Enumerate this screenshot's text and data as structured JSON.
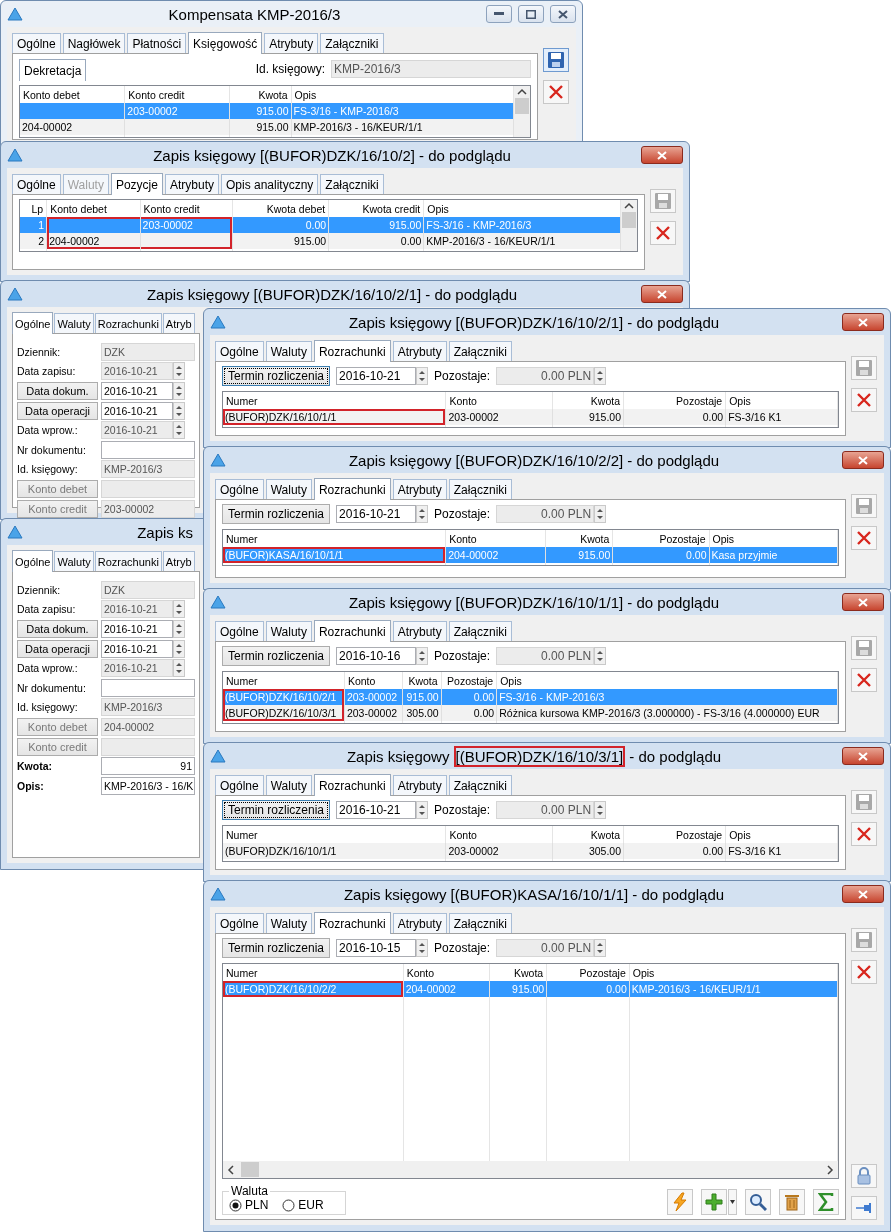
{
  "windows": [
    {
      "kind": "dekretacja",
      "title": [
        {
          "text": "Kompensata KMP-2016/3",
          "framed": false
        }
      ],
      "active": false,
      "controls": [
        {
          "kind": "minimize"
        },
        {
          "kind": "maximize"
        },
        {
          "kind": "close"
        }
      ],
      "tabs": [
        {
          "label": "Ogólne",
          "selected": false
        },
        {
          "label": "Nagłówek",
          "selected": false
        },
        {
          "label": "Płatności",
          "selected": false
        },
        {
          "label": "Księgowość",
          "selected": true
        },
        {
          "label": "Atrybuty",
          "selected": false
        },
        {
          "label": "Załączniki",
          "selected": false
        }
      ],
      "subtab": "Dekretacja",
      "id_label": "Id. księgowy:",
      "id_value": "KMP-2016/3",
      "table": {
        "scrollbar": {
          "kind": "vertical"
        },
        "columns": [
          {
            "label": "Konto debet",
            "kind": "text",
            "framed": false
          },
          {
            "label": "Konto credit",
            "kind": "text",
            "framed": false
          },
          {
            "label": "Kwota",
            "kind": "number",
            "framed": false
          },
          {
            "label": "Opis",
            "kind": "text",
            "framed": false
          }
        ],
        "rows": [
          {
            "selected": true,
            "cells": [
              null,
              "203-00002",
              "915.00",
              "FS-3/16 - KMP-2016/3"
            ]
          },
          {
            "selected": false,
            "cells": [
              "204-00002",
              null,
              "915.00",
              "KMP-2016/3 - 16/KEUR/1/1"
            ]
          }
        ]
      },
      "side_buttons": [
        {
          "kind": "save",
          "disabled": false
        },
        {
          "kind": "delete",
          "disabled": false
        }
      ]
    },
    {
      "kind": "pozycje",
      "title": [
        {
          "text": "Zapis księgowy [(BUFOR)DZK/16/10/2] - do podglądu",
          "framed": false
        }
      ],
      "active": true,
      "controls": [
        {
          "kind": "close"
        }
      ],
      "tabs": [
        {
          "label": "Ogólne",
          "selected": false,
          "disabled": false
        },
        {
          "label": "Waluty",
          "selected": false,
          "disabled": true
        },
        {
          "label": "Pozycje",
          "selected": true,
          "disabled": false
        },
        {
          "label": "Atrybuty",
          "selected": false,
          "disabled": false
        },
        {
          "label": "Opis analityczny",
          "selected": false,
          "disabled": false
        },
        {
          "label": "Załączniki",
          "selected": false,
          "disabled": false
        }
      ],
      "table": {
        "scrollbar": {
          "kind": "vertical"
        },
        "columns": [
          {
            "label": "Lp",
            "kind": "number",
            "framed": false
          },
          {
            "label": "Konto debet",
            "kind": "text",
            "framed": true
          },
          {
            "label": "Konto credit",
            "kind": "text",
            "framed": true
          },
          {
            "label": "Kwota debet",
            "kind": "number",
            "framed": false
          },
          {
            "label": "Kwota credit",
            "kind": "number",
            "framed": false
          },
          {
            "label": "Opis",
            "kind": "text",
            "framed": false
          }
        ],
        "rows": [
          {
            "selected": true,
            "cells": [
              "1",
              null,
              "203-00002",
              "0.00",
              "915.00",
              "FS-3/16 - KMP-2016/3"
            ]
          },
          {
            "selected": false,
            "cells": [
              "2",
              "204-00002",
              null,
              "915.00",
              "0.00",
              "KMP-2016/3 - 16/KEUR/1/1"
            ]
          }
        ]
      },
      "side_buttons": [
        {
          "kind": "save",
          "disabled": true
        },
        {
          "kind": "delete",
          "disabled": false
        }
      ]
    },
    {
      "kind": "form",
      "title": [
        {
          "text": "Zapis księgowy [(BUFOR)DZK/16/10/2/1] - do podglądu",
          "framed": false
        }
      ],
      "active": true,
      "controls": [
        {
          "kind": "close"
        }
      ],
      "tabs": [
        {
          "label": "Ogólne",
          "selected": true
        },
        {
          "label": "Waluty",
          "selected": false
        },
        {
          "label": "Rozrachunki",
          "selected": false
        },
        {
          "label": "Atryb",
          "selected": false
        }
      ],
      "rows": [
        {
          "label": "Dziennik:",
          "kind": "text",
          "value": "DZK",
          "disabled": true,
          "emphasis": false
        },
        {
          "label": "Data zapisu:",
          "kind": "date",
          "value": "2016-10-21",
          "disabled": true,
          "emphasis": false
        },
        {
          "label": "Data dokum.",
          "kind": "button-date",
          "value": "2016-10-21",
          "disabled": false,
          "emphasis": false
        },
        {
          "label": "Data operacji",
          "kind": "button-date",
          "value": "2016-10-21",
          "disabled": false,
          "emphasis": false
        },
        {
          "label": "Data wprow.:",
          "kind": "date",
          "value": "2016-10-21",
          "disabled": true,
          "emphasis": false
        },
        {
          "label": "Nr dokumentu:",
          "kind": "text",
          "disabled": false,
          "emphasis": false
        },
        {
          "label": "Id. księgowy:",
          "kind": "text",
          "value": "KMP-2016/3",
          "disabled": true,
          "emphasis": false
        },
        {
          "label": "Konto debet",
          "kind": "button",
          "disabled": true,
          "emphasis": false
        },
        {
          "label": "Konto credit",
          "kind": "button",
          "value": "203-00002",
          "disabled": true,
          "emphasis": false
        }
      ]
    },
    {
      "kind": "rozrachunki",
      "title": [
        {
          "text": "Zapis księgowy [(BUFOR)DZK/16/10/2/1] - do podglądu",
          "framed": false
        }
      ],
      "active": true,
      "controls": [
        {
          "kind": "close"
        }
      ],
      "tabs": [
        {
          "label": "Ogólne",
          "selected": false
        },
        {
          "label": "Waluty",
          "selected": false
        },
        {
          "label": "Rozrachunki",
          "selected": true
        },
        {
          "label": "Atrybuty",
          "selected": false
        },
        {
          "label": "Załączniki",
          "selected": false
        }
      ],
      "termin": {
        "label": "Termin rozliczenia",
        "focused": true
      },
      "date": "2016-10-21",
      "remaining_label": "Pozostaje:",
      "remaining": "0.00 PLN",
      "table": {
        "columns": [
          {
            "label": "Numer",
            "kind": "text",
            "framed": true
          },
          {
            "label": "Konto",
            "kind": "text",
            "framed": false
          },
          {
            "label": "Kwota",
            "kind": "number",
            "framed": false
          },
          {
            "label": "Pozostaje",
            "kind": "number",
            "framed": false
          },
          {
            "label": "Opis",
            "kind": "text",
            "framed": false
          }
        ],
        "rows": [
          {
            "selected": false,
            "cells": [
              "(BUFOR)DZK/16/10/1/1",
              "203-00002",
              "915.00",
              "0.00",
              "FS-3/16 K1"
            ]
          }
        ]
      },
      "side_buttons": [
        {
          "kind": "save",
          "disabled": true
        },
        {
          "kind": "delete",
          "disabled": false
        }
      ]
    },
    {
      "kind": "form",
      "title": [
        {
          "text": "Zapis ks",
          "framed": false
        }
      ],
      "tabs": [
        {
          "label": "Ogólne",
          "selected": true
        },
        {
          "label": "Waluty",
          "selected": false
        },
        {
          "label": "Rozrachunki",
          "selected": false
        },
        {
          "label": "Atryb",
          "selected": false
        }
      ],
      "rows": [
        {
          "label": "Dziennik:",
          "kind": "text",
          "value": "DZK",
          "disabled": true,
          "emphasis": false
        },
        {
          "label": "Data zapisu:",
          "kind": "date",
          "value": "2016-10-21",
          "disabled": true,
          "emphasis": false
        },
        {
          "label": "Data dokum.",
          "kind": "button-date",
          "value": "2016-10-21",
          "disabled": false,
          "emphasis": false
        },
        {
          "label": "Data operacji",
          "kind": "button-date",
          "value": "2016-10-21",
          "disabled": false,
          "emphasis": false
        },
        {
          "label": "Data wprow.:",
          "kind": "date",
          "value": "2016-10-21",
          "disabled": true,
          "emphasis": false
        },
        {
          "label": "Nr dokumentu:",
          "kind": "text",
          "disabled": false,
          "emphasis": false
        },
        {
          "label": "Id. księgowy:",
          "kind": "text",
          "value": "KMP-2016/3",
          "disabled": true,
          "emphasis": false
        },
        {
          "label": "Konto debet",
          "kind": "button",
          "value": "204-00002",
          "disabled": true,
          "emphasis": false
        },
        {
          "label": "Konto credit",
          "kind": "button",
          "disabled": true,
          "emphasis": false
        },
        {
          "label": "Kwota:",
          "kind": "amount",
          "value": "91",
          "disabled": false,
          "emphasis": true
        },
        {
          "label": "Opis:",
          "kind": "text",
          "value": "KMP-2016/3 - 16/K",
          "disabled": false,
          "emphasis": true
        }
      ]
    },
    {
      "kind": "rozrachunki",
      "title": [
        {
          "text": "Zapis księgowy [(BUFOR)DZK/16/10/2/2] - do podglądu",
          "framed": false
        }
      ],
      "active": true,
      "controls": [
        {
          "kind": "close"
        }
      ],
      "tabs": [
        {
          "label": "Ogólne",
          "selected": false
        },
        {
          "label": "Waluty",
          "selected": false
        },
        {
          "label": "Rozrachunki",
          "selected": true
        },
        {
          "label": "Atrybuty",
          "selected": false
        },
        {
          "label": "Załączniki",
          "selected": false
        }
      ],
      "termin": {
        "label": "Termin rozliczenia",
        "focused": false
      },
      "date": "2016-10-21",
      "remaining_label": "Pozostaje:",
      "remaining": "0.00 PLN",
      "table": {
        "columns": [
          {
            "label": "Numer",
            "kind": "text",
            "framed": true
          },
          {
            "label": "Konto",
            "kind": "text",
            "framed": false
          },
          {
            "label": "Kwota",
            "kind": "number",
            "framed": false
          },
          {
            "label": "Pozostaje",
            "kind": "number",
            "framed": false
          },
          {
            "label": "Opis",
            "kind": "text",
            "framed": false
          }
        ],
        "rows": [
          {
            "selected": true,
            "cells": [
              "(BUFOR)KASA/16/10/1/1",
              "204-00002",
              "915.00",
              "0.00",
              "Kasa przyjmie"
            ]
          }
        ]
      },
      "side_buttons": [
        {
          "kind": "save",
          "disabled": true
        },
        {
          "kind": "delete",
          "disabled": false
        }
      ]
    },
    {
      "kind": "rozrachunki",
      "title": [
        {
          "text": "Zapis księgowy [(BUFOR)DZK/16/10/1/1] - do podglądu",
          "framed": false
        }
      ],
      "active": true,
      "controls": [
        {
          "kind": "close"
        }
      ],
      "tabs": [
        {
          "label": "Ogólne",
          "selected": false
        },
        {
          "label": "Waluty",
          "selected": false
        },
        {
          "label": "Rozrachunki",
          "selected": true
        },
        {
          "label": "Atrybuty",
          "selected": false
        },
        {
          "label": "Załączniki",
          "selected": false
        }
      ],
      "termin": {
        "label": "Termin rozliczenia",
        "focused": false
      },
      "date": "2016-10-16",
      "remaining_label": "Pozostaje:",
      "remaining": "0.00 PLN",
      "table": {
        "columns": [
          {
            "label": "Numer",
            "kind": "text",
            "framed": true
          },
          {
            "label": "Konto",
            "kind": "text",
            "framed": false
          },
          {
            "label": "Kwota",
            "kind": "number",
            "framed": false
          },
          {
            "label": "Pozostaje",
            "kind": "number",
            "framed": false
          },
          {
            "label": "Opis",
            "kind": "text",
            "framed": false
          }
        ],
        "rows": [
          {
            "selected": true,
            "cells": [
              "(BUFOR)DZK/16/10/2/1",
              "203-00002",
              "915.00",
              "0.00",
              "FS-3/16 - KMP-2016/3"
            ]
          },
          {
            "selected": false,
            "cells": [
              "(BUFOR)DZK/16/10/3/1",
              "203-00002",
              "305.00",
              "0.00",
              "Różnica kursowa KMP-2016/3 (3.000000) - FS-3/16 (4.000000) EUR"
            ]
          }
        ]
      },
      "side_buttons": [
        {
          "kind": "save",
          "disabled": true
        },
        {
          "kind": "delete",
          "disabled": false
        }
      ]
    },
    {
      "kind": "rozrachunki",
      "title": [
        {
          "text": "Zapis księgowy ",
          "framed": false
        },
        {
          "text": "[(BUFOR)DZK/16/10/3/1]",
          "framed": true
        },
        {
          "text": " - do podglądu",
          "framed": false
        }
      ],
      "active": true,
      "controls": [
        {
          "kind": "close"
        }
      ],
      "tabs": [
        {
          "label": "Ogólne",
          "selected": false
        },
        {
          "label": "Waluty",
          "selected": false
        },
        {
          "label": "Rozrachunki",
          "selected": true
        },
        {
          "label": "Atrybuty",
          "selected": false
        },
        {
          "label": "Załączniki",
          "selected": false
        }
      ],
      "termin": {
        "label": "Termin rozliczenia",
        "focused": true
      },
      "date": "2016-10-21",
      "remaining_label": "Pozostaje:",
      "remaining": "0.00 PLN",
      "table": {
        "columns": [
          {
            "label": "Numer",
            "kind": "text",
            "framed": false
          },
          {
            "label": "Konto",
            "kind": "text",
            "framed": false
          },
          {
            "label": "Kwota",
            "kind": "number",
            "framed": false
          },
          {
            "label": "Pozostaje",
            "kind": "number",
            "framed": false
          },
          {
            "label": "Opis",
            "kind": "text",
            "framed": false
          }
        ],
        "rows": [
          {
            "selected": false,
            "cells": [
              "(BUFOR)DZK/16/10/1/1",
              "203-00002",
              "305.00",
              "0.00",
              "FS-3/16 K1"
            ]
          }
        ]
      },
      "side_buttons": [
        {
          "kind": "save",
          "disabled": true
        },
        {
          "kind": "delete",
          "disabled": false
        }
      ]
    },
    {
      "kind": "rozrachunki",
      "title": [
        {
          "text": "Zapis księgowy [(BUFOR)KASA/16/10/1/1] - do podglądu",
          "framed": false
        }
      ],
      "active": true,
      "controls": [
        {
          "kind": "close"
        }
      ],
      "tabs": [
        {
          "label": "Ogólne",
          "selected": false
        },
        {
          "label": "Waluty",
          "selected": false
        },
        {
          "label": "Rozrachunki",
          "selected": true
        },
        {
          "label": "Atrybuty",
          "selected": false
        },
        {
          "label": "Załączniki",
          "selected": false
        }
      ],
      "termin": {
        "label": "Termin rozliczenia",
        "focused": false
      },
      "date": "2016-10-15",
      "remaining_label": "Pozostaje:",
      "remaining": "0.00 PLN",
      "table": {
        "scrollbar": {
          "kind": "horizontal"
        },
        "columns": [
          {
            "label": "Numer",
            "kind": "text",
            "framed": true
          },
          {
            "label": "Konto",
            "kind": "text",
            "framed": false
          },
          {
            "label": "Kwota",
            "kind": "number",
            "framed": false
          },
          {
            "label": "Pozostaje",
            "kind": "number",
            "framed": false
          },
          {
            "label": "Opis",
            "kind": "text",
            "framed": false
          }
        ],
        "rows": [
          {
            "selected": true,
            "cells": [
              "(BUFOR)DZK/16/10/2/2",
              "204-00002",
              "915.00",
              "0.00",
              "KMP-2016/3 - 16/KEUR/1/1"
            ]
          }
        ]
      },
      "currency": {
        "label": "Waluta",
        "options": [
          {
            "label": "PLN",
            "selected": true
          },
          {
            "label": "EUR",
            "selected": false
          }
        ]
      },
      "actions": [
        {
          "kind": "lightning"
        },
        {
          "kind": "add"
        },
        {
          "kind": "search"
        },
        {
          "kind": "trash"
        },
        {
          "kind": "sum"
        }
      ],
      "side_buttons": [
        {
          "kind": "save",
          "disabled": true
        },
        {
          "kind": "delete",
          "disabled": false
        },
        {
          "kind": "lock",
          "disabled": false
        },
        {
          "kind": "pin",
          "disabled": false
        }
      ]
    }
  ]
}
